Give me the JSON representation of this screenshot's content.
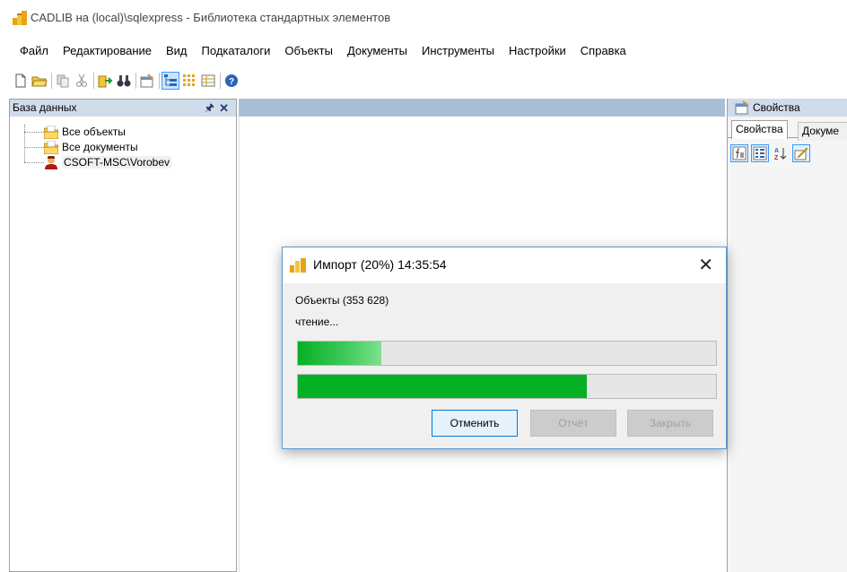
{
  "window": {
    "title": "CADLIB на (local)\\sqlexpress - Библиотека стандартных элементов"
  },
  "menu": [
    "Файл",
    "Редактирование",
    "Вид",
    "Подкаталоги",
    "Объекты",
    "Документы",
    "Инструменты",
    "Настройки",
    "Справка"
  ],
  "left_panel": {
    "title": "База данных",
    "tree": [
      {
        "label": "Все объекты",
        "icon": "folder-objects-icon"
      },
      {
        "label": "Все документы",
        "icon": "folder-documents-icon"
      },
      {
        "label": "CSOFT-MSC\\Vorobev",
        "icon": "user-icon"
      }
    ]
  },
  "right_panel": {
    "title": "Свойства",
    "tabs": [
      "Свойства",
      "Докуме"
    ]
  },
  "dialog": {
    "title": "Импорт (20%) 14:35:54",
    "objects_label": "Объекты (353 628)",
    "status": "чтение...",
    "progress_marquee_percent": 20,
    "progress_percent": 69,
    "buttons": {
      "cancel": "Отменить",
      "report": "Отчёт",
      "close": "Закрыть"
    }
  },
  "colors": {
    "progress": "#06b025",
    "accent": "#0078d7",
    "panel_header": "#cfdce9"
  }
}
